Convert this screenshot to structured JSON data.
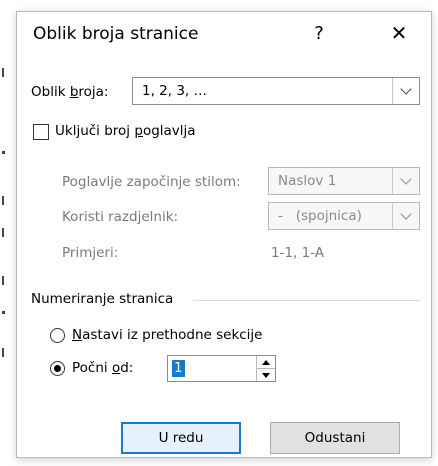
{
  "dialog": {
    "title": "Oblik broja stranice",
    "help_glyph": "?",
    "close_glyph": "✕"
  },
  "number_format": {
    "label_pre": "Oblik ",
    "label_u": "b",
    "label_post": "roja:",
    "value": "1, 2, 3, …"
  },
  "chapter": {
    "label_pre": "Uključi broj ",
    "label_u": "p",
    "label_post": "oglavlja",
    "checked": false,
    "style_label": "Poglavlje započinje stilom:",
    "style_value": "Naslov 1",
    "separator_label": "Koristi razdjelnik:",
    "separator_value": "-   (spojnica)",
    "examples_label": "Primjeri:",
    "examples_value": "1-1, 1-A"
  },
  "numbering": {
    "group_label": "Numeriranje stranica",
    "continue_u": "N",
    "continue_post": "astavi iz prethodne sekcije",
    "start_pre": "Počni ",
    "start_u": "o",
    "start_post": "d:",
    "start_value": "1",
    "selected": "start"
  },
  "buttons": {
    "ok": "U redu",
    "cancel": "Odustani"
  }
}
